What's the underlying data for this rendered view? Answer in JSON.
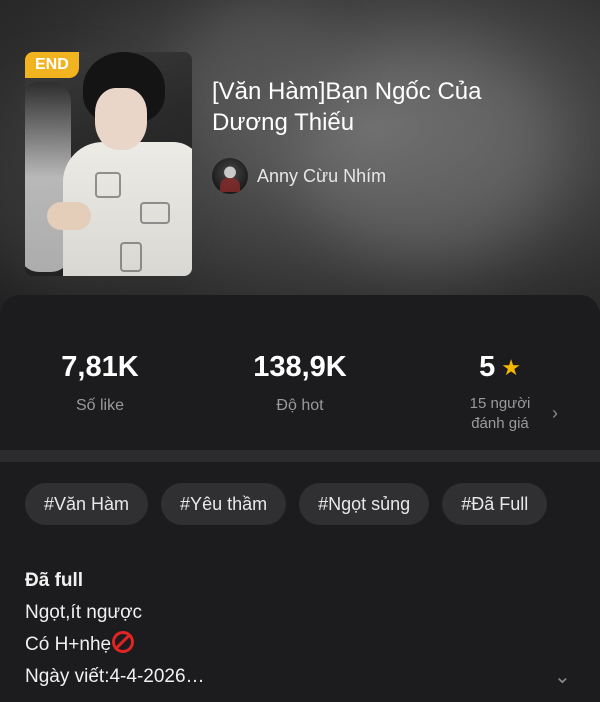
{
  "book": {
    "status_badge": "END",
    "title": "[Văn Hàm]Bạn Ngốc Của Dương Thiếu",
    "author": "Anny Cừu Nhím"
  },
  "stats": {
    "likes": {
      "value": "7,81K",
      "label": "Số like"
    },
    "hot": {
      "value": "138,9K",
      "label": "Độ hot"
    },
    "rating": {
      "value": "5",
      "label_line1": "15 người",
      "label_line2": "đánh giá"
    }
  },
  "tags": [
    "#Văn Hàm",
    "#Yêu thầm",
    "#Ngọt sủng",
    "#Đã Full"
  ],
  "description": {
    "line1": "Đã full",
    "line2": "Ngọt,ít ngược",
    "line3": "Có H+nhẹ",
    "line4": "Ngày viết:4-4-2026…"
  },
  "icons": {
    "star": "star-icon",
    "chevron_right": "chevron-right-icon",
    "chevron_down": "chevron-down-icon",
    "prohibited": "prohibited-icon"
  },
  "colors": {
    "accent_badge": "#f2b321",
    "star": "#f5b800",
    "background": "#1c1c1e",
    "tag_bg": "#303032"
  }
}
